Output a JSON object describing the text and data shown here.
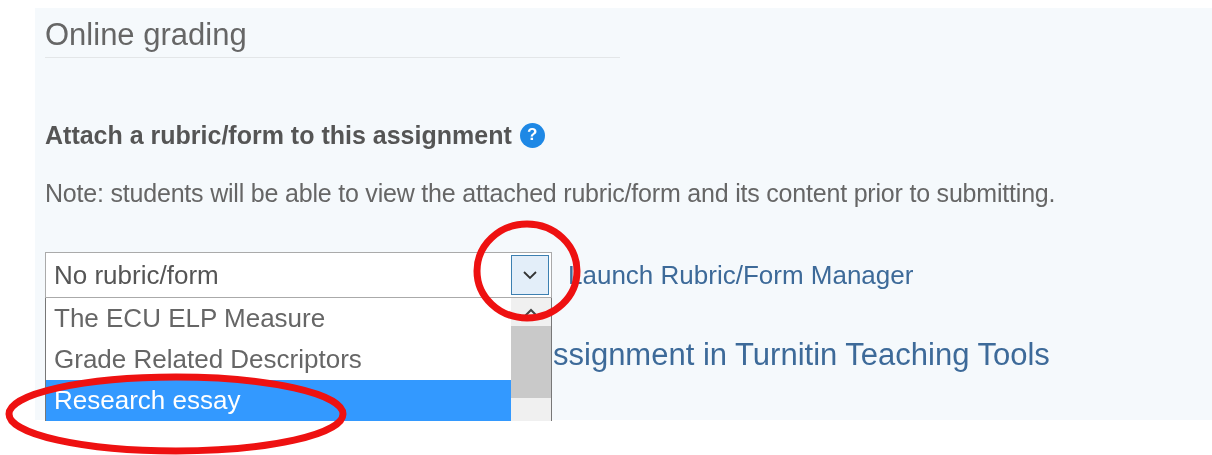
{
  "section": {
    "title": "Online grading"
  },
  "rubric": {
    "heading": "Attach a rubric/form to this assignment",
    "help": "?",
    "note": "Note: students will be able to view the attached rubric/form and its content prior to submitting.",
    "select": {
      "value": "No rubric/form",
      "expanded": true,
      "options": [
        {
          "label": "The ECU ELP Measure",
          "selected": false
        },
        {
          "label": "Grade Related Descriptors",
          "selected": false
        },
        {
          "label": "Research essay",
          "selected": true
        }
      ]
    },
    "link": "Launch Rubric/Form Manager"
  },
  "partial_heading": "ssignment in Turnitin Teaching Tools"
}
